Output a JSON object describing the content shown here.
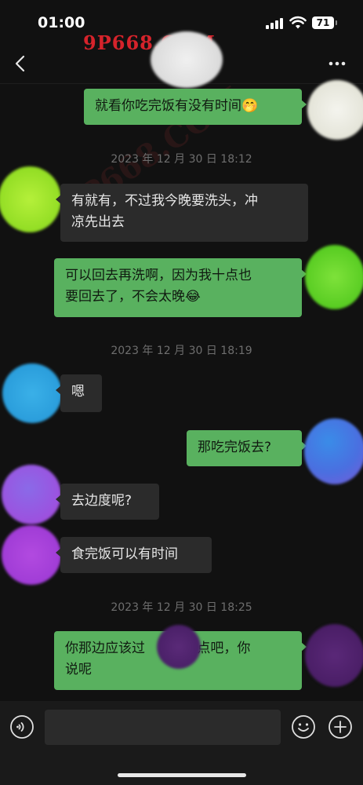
{
  "status_bar": {
    "time": "01:00",
    "battery": "71"
  },
  "watermark": {
    "site": "9P668.COM",
    "diagonal": "9P668.COM"
  },
  "colors": {
    "outgoing_bubble": "#59b15f",
    "incoming_bubble": "#2b2b2b",
    "background": "#111111",
    "watermark": "#d6232b"
  },
  "messages": [
    {
      "type": "message",
      "direction": "out",
      "text": "就看你吃完饭有没有时间🤭"
    },
    {
      "type": "timestamp",
      "text": "2023 年 12 月 30 日  18:12"
    },
    {
      "type": "message",
      "direction": "in",
      "line1": "有就有，不过我今晚要洗头，冲",
      "line2": "凉先出去"
    },
    {
      "type": "message",
      "direction": "out",
      "line1": "可以回去再洗啊，因为我十点也",
      "line2": "要回去了，不会太晚😂"
    },
    {
      "type": "timestamp",
      "text": "2023 年 12 月 30 日  18:19"
    },
    {
      "type": "message",
      "direction": "in",
      "text": "嗯"
    },
    {
      "type": "message",
      "direction": "out",
      "text": "那吃完饭去?"
    },
    {
      "type": "message",
      "direction": "in",
      "text": "去边度呢?"
    },
    {
      "type": "message",
      "direction": "in",
      "text": "食完饭可以有时间"
    },
    {
      "type": "timestamp",
      "text": "2023 年 12 月 30 日  18:25"
    },
    {
      "type": "message",
      "direction": "out",
      "line1": "你那边应该过      会近点吧，你",
      "line2": "说呢"
    }
  ],
  "icons": {
    "back": "chevron-left-icon",
    "more": "more-dots-icon",
    "voice": "voice-icon",
    "emoji": "emoji-icon",
    "plus": "plus-icon"
  }
}
